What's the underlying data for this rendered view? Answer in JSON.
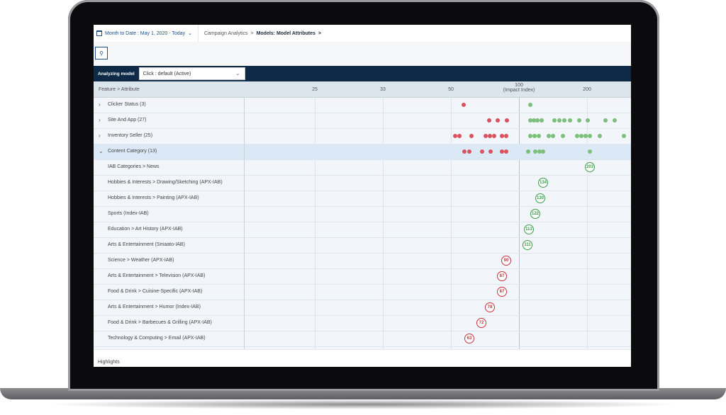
{
  "header": {
    "date_range": "Month to Date : May 1, 2020 - Today",
    "breadcrumb_1": "Campaign Analytics",
    "breadcrumb_sep": ">",
    "breadcrumb_2": "Models: Model Attributes",
    "breadcrumb_end": ">"
  },
  "model_bar": {
    "label": "Analyzing model",
    "selected_model": "Click : default (Active)"
  },
  "grid": {
    "feature_header": "Feature > Attribute",
    "ticks": [
      "25",
      "33",
      "50",
      "100",
      "200"
    ],
    "impact_label": "(Impact Index)",
    "groups": [
      {
        "label": "Clicker Status (3)"
      },
      {
        "label": "Site And App (27)"
      },
      {
        "label": "Inventory Seller (25)"
      },
      {
        "label": "Content Category (13)"
      }
    ],
    "attributes": [
      {
        "label": "IAB Categories > News",
        "value": "203"
      },
      {
        "label": "Hobbies & Interests > Drawing/Sketching (APX-IAB)",
        "value": "134"
      },
      {
        "label": "Hobbies & Interests > Painting (APX-IAB)",
        "value": "130"
      },
      {
        "label": "Sports (Index-IAB)",
        "value": "122"
      },
      {
        "label": "Education > Art History (APX-IAB)",
        "value": "113"
      },
      {
        "label": "Arts & Entertainment (Smaato-IAB)",
        "value": "111"
      },
      {
        "label": "Science > Weather (APX-IAB)",
        "value": "90"
      },
      {
        "label": "Arts & Entertainment > Television (APX-IAB)",
        "value": "87"
      },
      {
        "label": "Food & Drink > Cuisine-Specific (APX-IAB)",
        "value": "87"
      },
      {
        "label": "Arts & Entertainment > Humor (Index-IAB)",
        "value": "78"
      },
      {
        "label": "Food & Drink > Barbecues & Grilling (APX-IAB)",
        "value": "72"
      },
      {
        "label": "Technology & Computing > Email (APX-IAB)",
        "value": "63"
      }
    ]
  },
  "footer": {
    "label": "Highlights"
  },
  "colors": {
    "navy": "#0e2a47",
    "red": "#c9303d",
    "green": "#3a9a4a"
  }
}
